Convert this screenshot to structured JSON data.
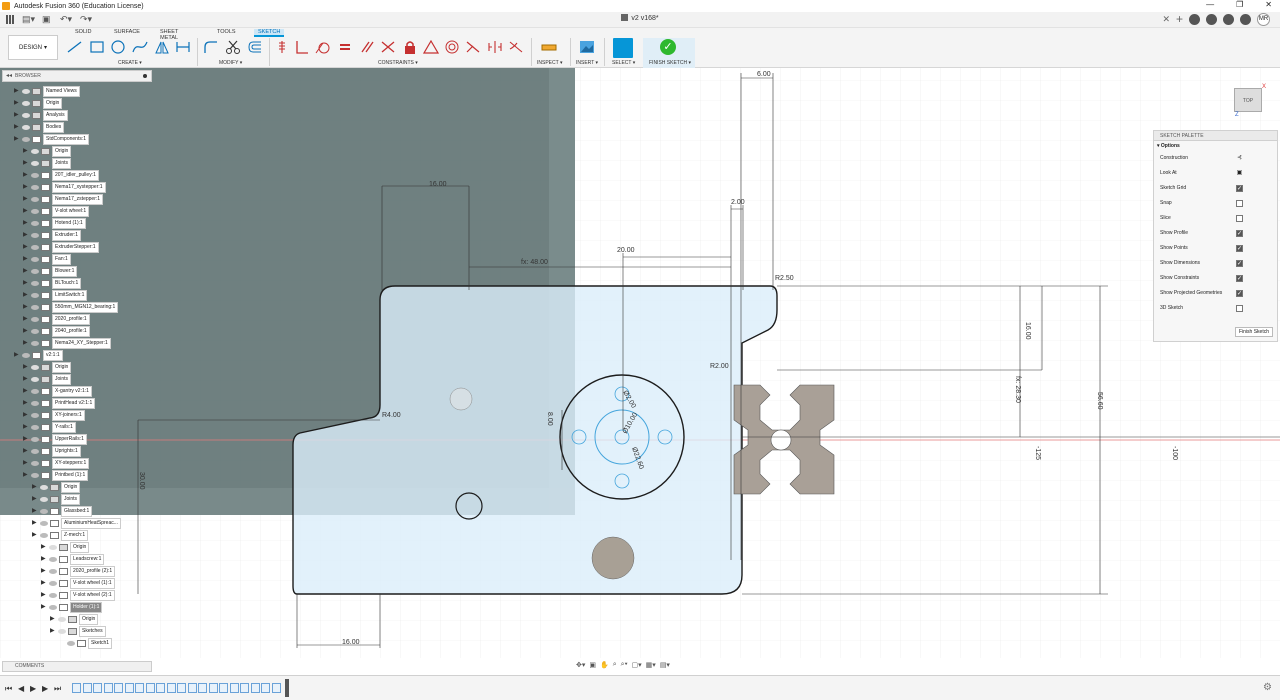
{
  "app": {
    "title": "Autodesk Fusion 360 (Education License)",
    "document_tab": "v2 v168*",
    "user_initials": "MR"
  },
  "toolbar": {
    "design_label": "DESIGN",
    "tabs": [
      "SOLID",
      "SURFACE",
      "SHEET METAL",
      "TOOLS",
      "SKETCH"
    ],
    "active_tab": "SKETCH",
    "groups": {
      "create": "CREATE",
      "modify": "MODIFY",
      "constraints": "CONSTRAINTS",
      "inspect": "INSPECT",
      "insert": "INSERT",
      "select": "SELECT",
      "finish": "FINISH SKETCH"
    }
  },
  "browser": {
    "title": "BROWSER",
    "items": [
      {
        "label": "Named Views",
        "level": 1,
        "type": "folder"
      },
      {
        "label": "Origin",
        "level": 1,
        "type": "folder"
      },
      {
        "label": "Analysis",
        "level": 1,
        "type": "folder"
      },
      {
        "label": "Bodies",
        "level": 1,
        "type": "folder"
      },
      {
        "label": "StdComponents:1",
        "level": 1,
        "type": "component"
      },
      {
        "label": "Origin",
        "level": 2,
        "type": "folder"
      },
      {
        "label": "Joints",
        "level": 2,
        "type": "folder"
      },
      {
        "label": "20T_idler_pulley:1",
        "level": 2,
        "type": "component"
      },
      {
        "label": "Nema17_xystepper:1",
        "level": 2,
        "type": "component"
      },
      {
        "label": "Nema17_zstepper:1",
        "level": 2,
        "type": "component"
      },
      {
        "label": "V-slot wheel:1",
        "level": 2,
        "type": "component"
      },
      {
        "label": "Hotend (1):1",
        "level": 2,
        "type": "component"
      },
      {
        "label": "Extruder:1",
        "level": 2,
        "type": "component"
      },
      {
        "label": "ExtruderStepper:1",
        "level": 2,
        "type": "component"
      },
      {
        "label": "Fan:1",
        "level": 2,
        "type": "component"
      },
      {
        "label": "Blower:1",
        "level": 2,
        "type": "component"
      },
      {
        "label": "BLTouch:1",
        "level": 2,
        "type": "component"
      },
      {
        "label": "LimitSwitch:1",
        "level": 2,
        "type": "component"
      },
      {
        "label": "550mm_MGN12_bearing:1",
        "level": 2,
        "type": "component"
      },
      {
        "label": "2020_profile:1",
        "level": 2,
        "type": "component"
      },
      {
        "label": "2040_profile:1",
        "level": 2,
        "type": "component"
      },
      {
        "label": "Nema24_XY_Stepper:1",
        "level": 2,
        "type": "component"
      },
      {
        "label": "v2:1:1",
        "level": 1,
        "type": "component"
      },
      {
        "label": "Origin",
        "level": 2,
        "type": "folder"
      },
      {
        "label": "Joints",
        "level": 2,
        "type": "folder"
      },
      {
        "label": "X-gantry v2:1:1",
        "level": 2,
        "type": "component"
      },
      {
        "label": "PrintHead v2:1:1",
        "level": 2,
        "type": "component"
      },
      {
        "label": "XY-joiners:1",
        "level": 2,
        "type": "component"
      },
      {
        "label": "Y-rails:1",
        "level": 2,
        "type": "component"
      },
      {
        "label": "UpperRails:1",
        "level": 2,
        "type": "component"
      },
      {
        "label": "Uprights:1",
        "level": 2,
        "type": "component"
      },
      {
        "label": "XY-steppers:1",
        "level": 2,
        "type": "component"
      },
      {
        "label": "Printbed (1):1",
        "level": 2,
        "type": "component"
      },
      {
        "label": "Origin",
        "level": 3,
        "type": "folder"
      },
      {
        "label": "Joints",
        "level": 3,
        "type": "folder"
      },
      {
        "label": "Glassbed:1",
        "level": 3,
        "type": "component"
      },
      {
        "label": "AluminiumHeatSpreac...",
        "level": 3,
        "type": "component"
      },
      {
        "label": "Z-mech:1",
        "level": 3,
        "type": "component"
      },
      {
        "label": "Origin",
        "level": 4,
        "type": "folder"
      },
      {
        "label": "Leadscrew:1",
        "level": 4,
        "type": "component"
      },
      {
        "label": "2020_profile (2):1",
        "level": 4,
        "type": "component"
      },
      {
        "label": "V-slot wheel (1):1",
        "level": 4,
        "type": "component"
      },
      {
        "label": "V-slot wheel (2):1",
        "level": 4,
        "type": "component"
      },
      {
        "label": "Holder (1):1",
        "level": 4,
        "type": "component",
        "selected": true
      },
      {
        "label": "Origin",
        "level": 5,
        "type": "folder"
      },
      {
        "label": "Sketches",
        "level": 5,
        "type": "folder"
      },
      {
        "label": "Sketch1",
        "level": 6,
        "type": "sketch"
      }
    ]
  },
  "sketch_palette": {
    "title": "SKETCH PALETTE",
    "section": "Options",
    "options": [
      {
        "label": "Construction",
        "control": "icon"
      },
      {
        "label": "Look At",
        "control": "icon"
      },
      {
        "label": "Sketch Grid",
        "checked": true
      },
      {
        "label": "Snap",
        "checked": false
      },
      {
        "label": "Slice",
        "checked": false
      },
      {
        "label": "Show Profile",
        "checked": true
      },
      {
        "label": "Show Points",
        "checked": true
      },
      {
        "label": "Show Dimensions",
        "checked": true
      },
      {
        "label": "Show Constraints",
        "checked": true
      },
      {
        "label": "Show Projected Geometries",
        "checked": true
      },
      {
        "label": "3D Sketch",
        "checked": false
      }
    ],
    "finish_button": "Finish Sketch"
  },
  "viewcube": {
    "face": "TOP",
    "x_axis": "X",
    "z_axis": "Z"
  },
  "dimensions": {
    "d1": "6.00",
    "d2": "16.00",
    "d3": "2.00",
    "d4": "20.00",
    "d5": "fx: 48.00",
    "d6": "R2.50",
    "d7": "16.00",
    "d8": "fx: 28.30",
    "d9": "56.60",
    "d10": "R2.00",
    "d11": "R4.00",
    "d12": "8.00",
    "d13": "30.00",
    "d14": "16.00",
    "d15": "-125",
    "d16": "-100",
    "d17": "Ø2.00",
    "d18": "Ø10.00",
    "d19": "Ø22.60"
  },
  "comments": {
    "title": "COMMENTS"
  },
  "colors": {
    "accent": "#0696d7",
    "finish_green": "#2eb82e",
    "sketch_fill": "#dbeefa",
    "overlay": "#5b6e6e"
  }
}
